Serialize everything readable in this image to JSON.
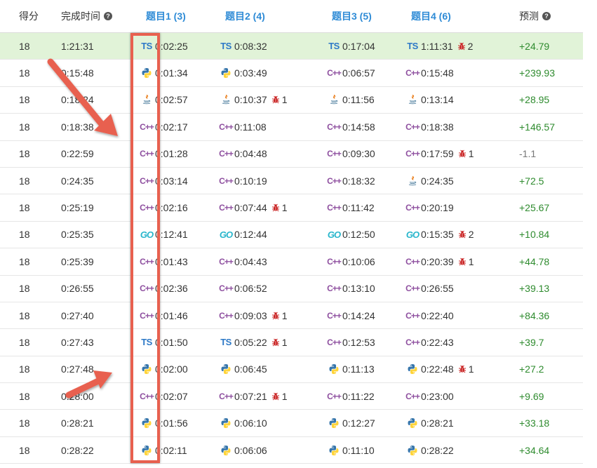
{
  "headers": {
    "score": "得分",
    "finish_time": "完成时间",
    "p1": "题目1 (3)",
    "p2": "题目2 (4)",
    "p3": "题目3 (5)",
    "p4": "题目4 (6)",
    "prediction": "预测",
    "help_glyph": "?"
  },
  "colors": {
    "highlight_row": "#e1f3d8",
    "header_link": "#2e8bd6",
    "positive": "#2e8b2e",
    "annotation_red": "#e8604f"
  },
  "rows": [
    {
      "score": "18",
      "time": "1:21:31",
      "p1": {
        "lang": "ts",
        "time": "0:02:25"
      },
      "p2": {
        "lang": "ts",
        "time": "0:08:32"
      },
      "p3": {
        "lang": "ts",
        "time": "0:17:04"
      },
      "p4": {
        "lang": "ts",
        "time": "1:11:31",
        "bug": "2"
      },
      "pred": "+24.79",
      "highlight": true
    },
    {
      "score": "18",
      "time": "0:15:48",
      "p1": {
        "lang": "python",
        "time": "0:01:34"
      },
      "p2": {
        "lang": "python",
        "time": "0:03:49"
      },
      "p3": {
        "lang": "cpp",
        "time": "0:06:57"
      },
      "p4": {
        "lang": "cpp",
        "time": "0:15:48"
      },
      "pred": "+239.93"
    },
    {
      "score": "18",
      "time": "0:18:24",
      "p1": {
        "lang": "java",
        "time": "0:02:57"
      },
      "p2": {
        "lang": "java",
        "time": "0:10:37",
        "bug": "1"
      },
      "p3": {
        "lang": "java",
        "time": "0:11:56"
      },
      "p4": {
        "lang": "java",
        "time": "0:13:14"
      },
      "pred": "+28.95"
    },
    {
      "score": "18",
      "time": "0:18:38",
      "p1": {
        "lang": "cpp",
        "time": "0:02:17"
      },
      "p2": {
        "lang": "cpp",
        "time": "0:11:08"
      },
      "p3": {
        "lang": "cpp",
        "time": "0:14:58"
      },
      "p4": {
        "lang": "cpp",
        "time": "0:18:38"
      },
      "pred": "+146.57"
    },
    {
      "score": "18",
      "time": "0:22:59",
      "p1": {
        "lang": "cpp",
        "time": "0:01:28"
      },
      "p2": {
        "lang": "cpp",
        "time": "0:04:48"
      },
      "p3": {
        "lang": "cpp",
        "time": "0:09:30"
      },
      "p4": {
        "lang": "cpp",
        "time": "0:17:59",
        "bug": "1"
      },
      "pred": "-1.1"
    },
    {
      "score": "18",
      "time": "0:24:35",
      "p1": {
        "lang": "cpp",
        "time": "0:03:14"
      },
      "p2": {
        "lang": "cpp",
        "time": "0:10:19"
      },
      "p3": {
        "lang": "cpp",
        "time": "0:18:32"
      },
      "p4": {
        "lang": "java",
        "time": "0:24:35"
      },
      "pred": "+72.5"
    },
    {
      "score": "18",
      "time": "0:25:19",
      "p1": {
        "lang": "cpp",
        "time": "0:02:16"
      },
      "p2": {
        "lang": "cpp",
        "time": "0:07:44",
        "bug": "1"
      },
      "p3": {
        "lang": "cpp",
        "time": "0:11:42"
      },
      "p4": {
        "lang": "cpp",
        "time": "0:20:19"
      },
      "pred": "+25.67"
    },
    {
      "score": "18",
      "time": "0:25:35",
      "p1": {
        "lang": "go",
        "time": "0:12:41"
      },
      "p2": {
        "lang": "go",
        "time": "0:12:44"
      },
      "p3": {
        "lang": "go",
        "time": "0:12:50"
      },
      "p4": {
        "lang": "go",
        "time": "0:15:35",
        "bug": "2"
      },
      "pred": "+10.84"
    },
    {
      "score": "18",
      "time": "0:25:39",
      "p1": {
        "lang": "cpp",
        "time": "0:01:43"
      },
      "p2": {
        "lang": "cpp",
        "time": "0:04:43"
      },
      "p3": {
        "lang": "cpp",
        "time": "0:10:06"
      },
      "p4": {
        "lang": "cpp",
        "time": "0:20:39",
        "bug": "1"
      },
      "pred": "+44.78"
    },
    {
      "score": "18",
      "time": "0:26:55",
      "p1": {
        "lang": "cpp",
        "time": "0:02:36"
      },
      "p2": {
        "lang": "cpp",
        "time": "0:06:52"
      },
      "p3": {
        "lang": "cpp",
        "time": "0:13:10"
      },
      "p4": {
        "lang": "cpp",
        "time": "0:26:55"
      },
      "pred": "+39.13"
    },
    {
      "score": "18",
      "time": "0:27:40",
      "p1": {
        "lang": "cpp",
        "time": "0:01:46"
      },
      "p2": {
        "lang": "cpp",
        "time": "0:09:03",
        "bug": "1"
      },
      "p3": {
        "lang": "cpp",
        "time": "0:14:24"
      },
      "p4": {
        "lang": "cpp",
        "time": "0:22:40"
      },
      "pred": "+84.36"
    },
    {
      "score": "18",
      "time": "0:27:43",
      "p1": {
        "lang": "ts",
        "time": "0:01:50"
      },
      "p2": {
        "lang": "ts",
        "time": "0:05:22",
        "bug": "1"
      },
      "p3": {
        "lang": "cpp",
        "time": "0:12:53"
      },
      "p4": {
        "lang": "cpp",
        "time": "0:22:43"
      },
      "pred": "+39.7"
    },
    {
      "score": "18",
      "time": "0:27:48",
      "p1": {
        "lang": "python",
        "time": "0:02:00"
      },
      "p2": {
        "lang": "python",
        "time": "0:06:45"
      },
      "p3": {
        "lang": "python",
        "time": "0:11:13"
      },
      "p4": {
        "lang": "python",
        "time": "0:22:48",
        "bug": "1"
      },
      "pred": "+27.2"
    },
    {
      "score": "18",
      "time": "0:28:00",
      "p1": {
        "lang": "cpp",
        "time": "0:02:07"
      },
      "p2": {
        "lang": "cpp",
        "time": "0:07:21",
        "bug": "1"
      },
      "p3": {
        "lang": "cpp",
        "time": "0:11:22"
      },
      "p4": {
        "lang": "cpp",
        "time": "0:23:00"
      },
      "pred": "+9.69"
    },
    {
      "score": "18",
      "time": "0:28:21",
      "p1": {
        "lang": "python",
        "time": "0:01:56"
      },
      "p2": {
        "lang": "python",
        "time": "0:06:10"
      },
      "p3": {
        "lang": "python",
        "time": "0:12:27"
      },
      "p4": {
        "lang": "python",
        "time": "0:28:21"
      },
      "pred": "+33.18"
    },
    {
      "score": "18",
      "time": "0:28:22",
      "p1": {
        "lang": "python",
        "time": "0:02:11"
      },
      "p2": {
        "lang": "python",
        "time": "0:06:06"
      },
      "p3": {
        "lang": "python",
        "time": "0:11:10"
      },
      "p4": {
        "lang": "python",
        "time": "0:28:22"
      },
      "pred": "+34.64"
    }
  ]
}
